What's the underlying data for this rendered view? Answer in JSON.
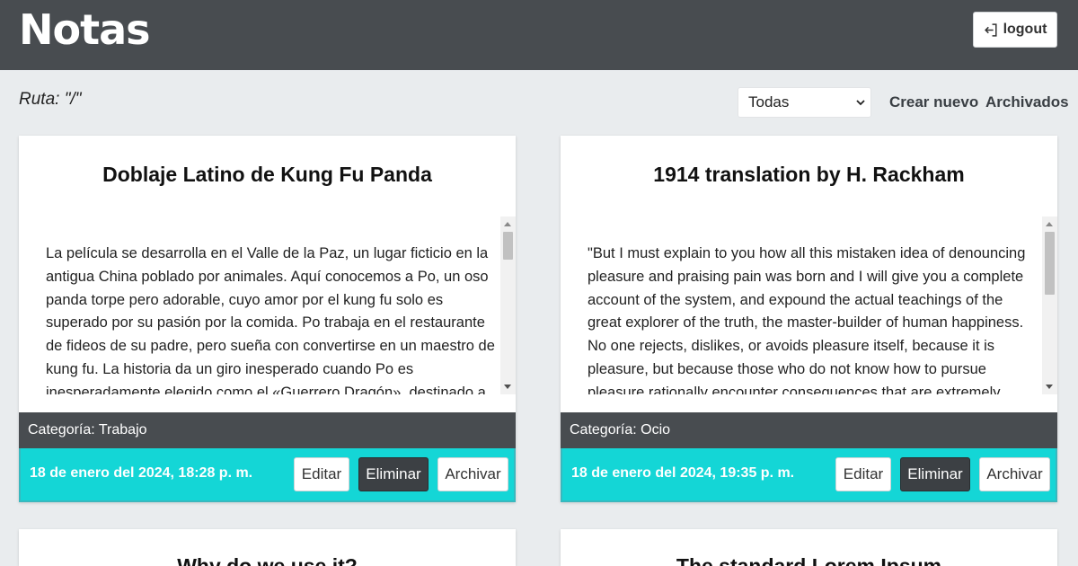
{
  "header": {
    "title": "Notas",
    "logout_label": "logout"
  },
  "toolbar": {
    "route": "Ruta: \"/\"",
    "filter_selected": "Todas",
    "create_new": "Crear nuevo",
    "archived": "Archivados"
  },
  "notes": [
    {
      "title": "Doblaje Latino de Kung Fu Panda",
      "body": "La película se desarrolla en el Valle de la Paz, un lugar ficticio en la antigua China poblado por animales. Aquí conocemos a Po, un oso panda torpe pero adorable, cuyo amor por el kung fu solo es superado por su pasión por la comida. Po trabaja en el restaurante de fideos de su padre, pero sueña con convertirse en un maestro de kung fu. La historia da un giro inesperado cuando Po es inesperadamente elegido como el «Guerrero Dragón», destinado a",
      "category": "Categoría: Trabajo",
      "date": "18 de enero del 2024, 18:28 p. m.",
      "scroll_position": 0.0
    },
    {
      "title": "1914 translation by H. Rackham",
      "body": "\"But I must explain to you how all this mistaken idea of denouncing pleasure and praising pain was born and I will give you a complete account of the system, and expound the actual teachings of the great explorer of the truth, the master-builder of human happiness. No one rejects, dislikes, or avoids pleasure itself, because it is pleasure, but because those who do not know how to pursue pleasure rationally encounter consequences that are extremely",
      "category": "Categoría: Ocio",
      "date": "18 de enero del 2024, 19:35 p. m.",
      "scroll_position": 0.0
    },
    {
      "title": "Why do we use it?"
    },
    {
      "title": "The standard Lorem Ipsum"
    }
  ],
  "buttons": {
    "edit": "Editar",
    "delete": "Eliminar",
    "archive": "Archivar"
  },
  "colors": {
    "header_bg": "#484c50",
    "accent": "#14d6d6",
    "page_bg": "#e9ecee"
  },
  "icons": {
    "logout": "logout-icon",
    "select": "chevron-down-icon"
  }
}
